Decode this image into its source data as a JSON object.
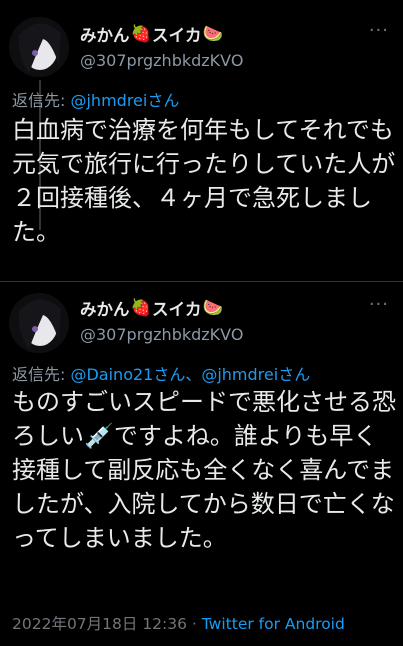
{
  "tweets": [
    {
      "display_name": "みかん",
      "display_name_mid": "スイカ",
      "strawberry_emoji": "🍓",
      "watermelon_emoji": "🍉",
      "handle": "@307prgzhbkdzKVO",
      "more_label": "···",
      "reply_prefix": "返信先: ",
      "reply_to": "@jhmdreiさん",
      "text": "白血病で治療を何年もしてそれでも元気で旅行に行ったりしていた人が２回接種後、４ヶ月で急死しました。"
    },
    {
      "display_name": "みかん",
      "display_name_mid": "スイカ",
      "strawberry_emoji": "🍓",
      "watermelon_emoji": "🍉",
      "handle": "@307prgzhbkdzKVO",
      "more_label": "···",
      "reply_prefix": "返信先: ",
      "reply_to": "@Daino21さん、@jhmdreiさん",
      "text_part1": "ものすごいスピードで悪化させる恐ろしい",
      "syringe_emoji": "💉",
      "text_part2": "ですよね。誰よりも早く接種して副反応も全くなく喜んでましたが、入院してから数日で亡くなってしまいました。",
      "timestamp": "2022年07月18日 12:36",
      "dot": " · ",
      "source": "Twitter for Android"
    }
  ],
  "colors": {
    "background": "#000000",
    "text": "#e7e9ea",
    "secondary": "#8b98a5",
    "link": "#1d9bf0"
  }
}
